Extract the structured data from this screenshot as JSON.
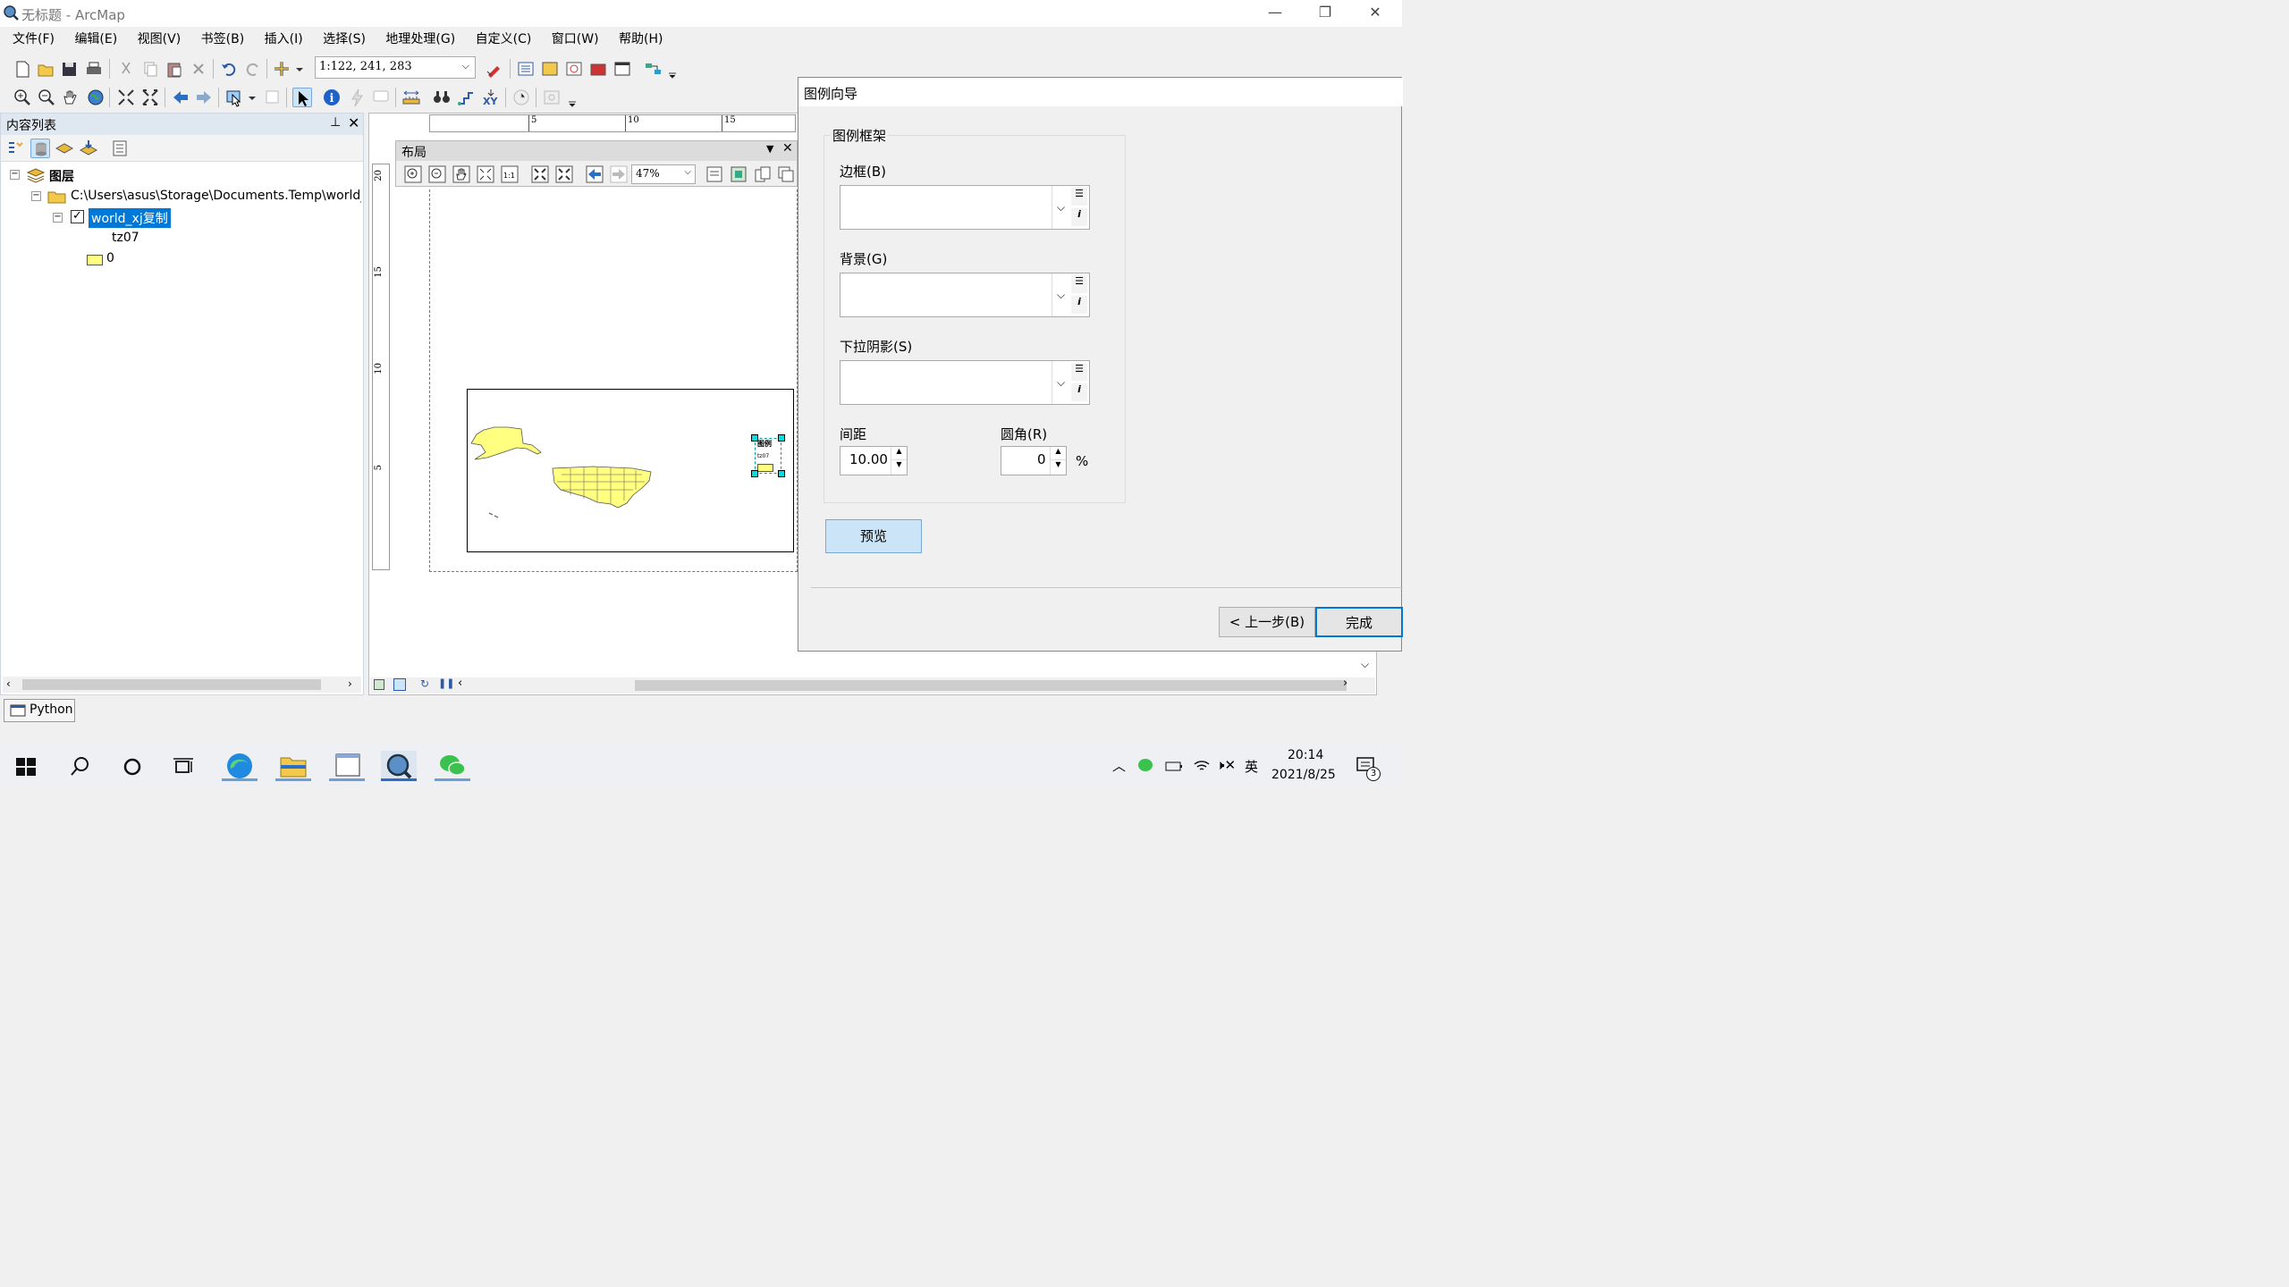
{
  "window": {
    "title": "无标题 - ArcMap",
    "min_glyph": "—",
    "max_glyph": "❐",
    "close_glyph": "✕"
  },
  "menu": [
    "文件(F)",
    "编辑(E)",
    "视图(V)",
    "书签(B)",
    "插入(I)",
    "选择(S)",
    "地理处理(G)",
    "自定义(C)",
    "窗口(W)",
    "帮助(H)"
  ],
  "toolbar": {
    "scale_value": "1:122, 241, 283"
  },
  "toc": {
    "title": "内容列表",
    "root_label": "图层",
    "folder_path": "C:\\Users\\asus\\Storage\\Documents.Temp\\world_",
    "layer_name": "world_xj复制",
    "field_name": "tz07",
    "class_value": "0"
  },
  "layout": {
    "title": "布局",
    "zoom": "47%",
    "ruler_h": [
      "5",
      "10",
      "15"
    ],
    "ruler_v": [
      "20",
      "15",
      "10",
      "5"
    ],
    "legend_title": "图例",
    "legend_item": "tz07"
  },
  "dialog": {
    "title": "图例向导",
    "group_label": "图例框架",
    "border_label": "边框(B)",
    "background_label": "背景(G)",
    "shadow_label": "下拉阴影(S)",
    "gap_label": "间距",
    "gap_value": "10.00",
    "round_label": "圆角(R)",
    "round_value": "0",
    "percent": "%",
    "preview_button": "预览",
    "back_button": "< 上一步(B)",
    "finish_button": "完成"
  },
  "python_tab": "Python",
  "taskbar": {
    "time": "20:14",
    "date": "2021/8/25",
    "ime": "英",
    "notif_count": "3"
  },
  "colors": {
    "selection": "#0078d7",
    "feature_fill": "#ffff80",
    "accent": "#cce4f7"
  }
}
